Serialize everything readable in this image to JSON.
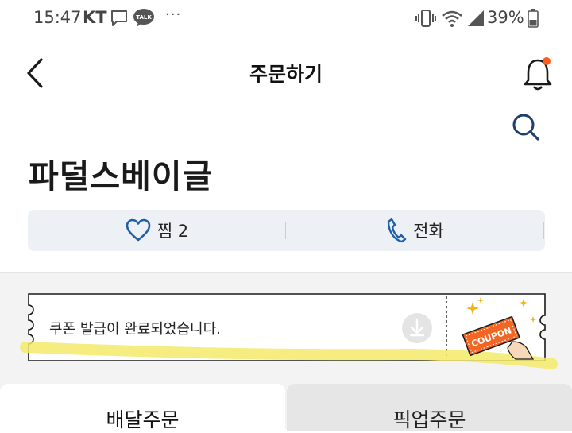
{
  "status_bar": {
    "time": "15:47",
    "carrier": "KT",
    "talk_badge": "TALK",
    "more": "···",
    "battery": "39%"
  },
  "header": {
    "title": "주문하기",
    "notification_dot_color": "#ff5a1f"
  },
  "store": {
    "name": "파덜스베이글"
  },
  "actions": {
    "like_label": "찜 2",
    "call_label": "전화"
  },
  "coupon": {
    "message": "쿠폰 발급이 완료되었습니다.",
    "art_label": "COUPON",
    "accent": "#f26522"
  },
  "tabs": {
    "delivery": "배달주문",
    "pickup": "픽업주문"
  },
  "colors": {
    "icon_blue": "#1f5ea8",
    "highlight": "#f3ea6a"
  }
}
